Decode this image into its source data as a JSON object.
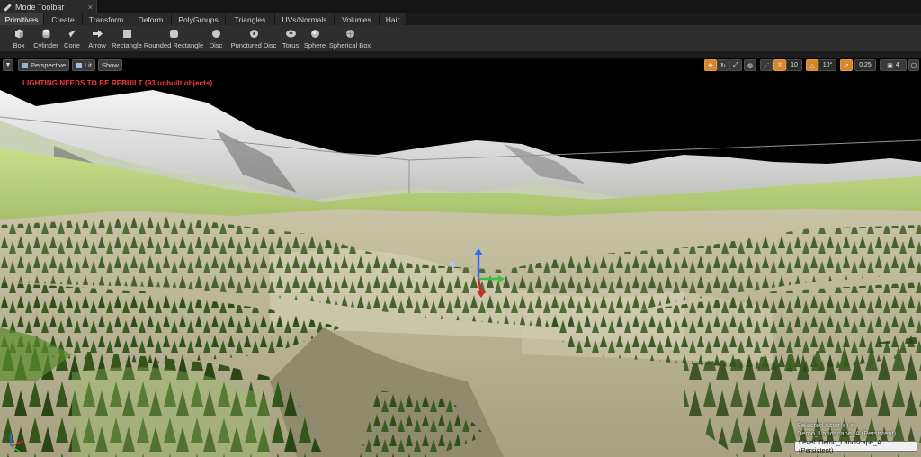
{
  "window": {
    "tab_title": "Mode Toolbar",
    "close_glyph": "×",
    "icon": "wrench-icon"
  },
  "categories": [
    {
      "label": "Primitives",
      "active": true
    },
    {
      "label": "Create"
    },
    {
      "label": "Transform"
    },
    {
      "label": "Deform"
    },
    {
      "label": "PolyGroups"
    },
    {
      "label": "Triangles"
    },
    {
      "label": "UVs/Normals"
    },
    {
      "label": "Volumes"
    },
    {
      "label": "Hair"
    }
  ],
  "tools": [
    {
      "label": "Box",
      "icon": "box-icon"
    },
    {
      "label": "Cylinder",
      "icon": "cylinder-icon"
    },
    {
      "label": "Cone",
      "icon": "cone-icon"
    },
    {
      "label": "Arrow",
      "icon": "arrow-icon"
    },
    {
      "label": "Rectangle",
      "icon": "rectangle-icon"
    },
    {
      "label": "Rounded Rectangle",
      "icon": "rounded-rectangle-icon"
    },
    {
      "label": "Disc",
      "icon": "disc-icon"
    },
    {
      "label": "Punctured Disc",
      "icon": "punctured-disc-icon"
    },
    {
      "label": "Torus",
      "icon": "torus-icon"
    },
    {
      "label": "Sphere",
      "icon": "sphere-icon"
    },
    {
      "label": "Spherical Box",
      "icon": "spherical-box-icon"
    }
  ],
  "viewport": {
    "perspective_label": "Perspective",
    "lit_label": "Lit",
    "show_label": "Show",
    "grid_snap_value": "10",
    "rotation_snap_value": "10°",
    "scale_snap_value": "0.25",
    "camera_speed_value": "4",
    "warning": "LIGHTING NEEDS TO BE REBUILT (93 unbuilt objects)",
    "selected_actor_line1": "Selected Actor(s) in:",
    "selected_actor_line2": "Demo_Landscape_A (Persistent)",
    "level_label": "Level:  Demo_Landscape_A (Persistent)"
  },
  "colors": {
    "accent_orange": "#d7862b",
    "warning_red": "#ff3a3a",
    "toolbar_bg": "#2e2e2e"
  }
}
